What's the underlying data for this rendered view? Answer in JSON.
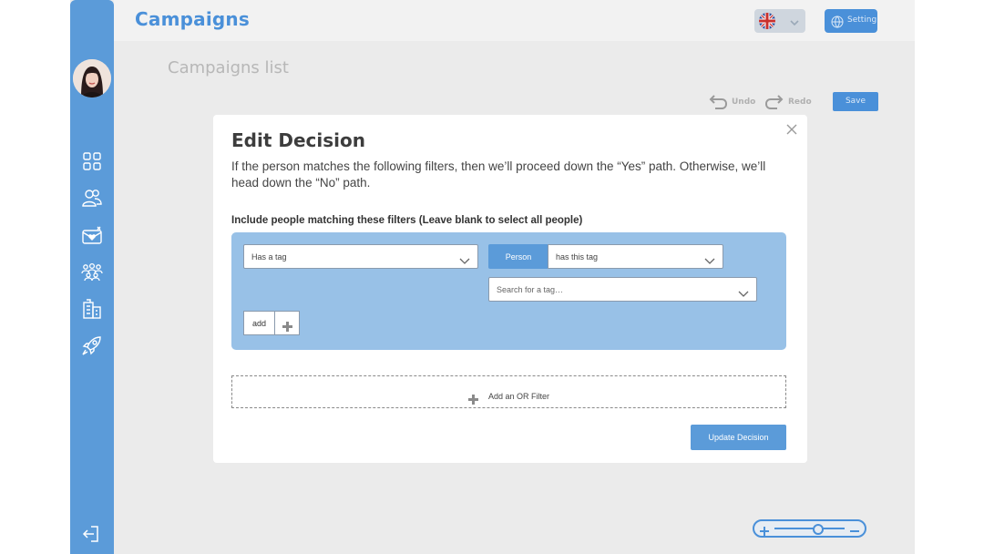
{
  "app": {
    "title": "Campaigns",
    "page_heading": "Campaigns list",
    "setting_label": "Setting",
    "undo_label": "Undo",
    "redo_label": "Redo",
    "save_label": "Save",
    "language": "en-GB",
    "zoom_level": 0.62,
    "colors": {
      "accent": "#5b9bd9",
      "brand_title": "#4a90d9",
      "filter_panel": "#98c1e7"
    }
  },
  "sidebar": {
    "items": [
      {
        "icon": "dashboard-grid-icon"
      },
      {
        "icon": "contacts-icon"
      },
      {
        "icon": "campaign-mail-icon"
      },
      {
        "icon": "community-icon"
      },
      {
        "icon": "buildings-icon"
      },
      {
        "icon": "rocket-icon"
      }
    ],
    "footer_icon": "logout-icon"
  },
  "modal": {
    "title": "Edit Decision",
    "description": "If the person matches the following filters, then we’ll proceed down the “Yes” path. Otherwise, we’ll head down the “No” path.",
    "filters_label": "Include people matching these filters (Leave blank to select all people)",
    "condition_type": "Has a tag",
    "subject": "Person",
    "operator": "has this tag",
    "tag_search_placeholder": "Search for a tag…",
    "add_label": "add",
    "or_filter_label": "Add an OR Filter",
    "submit_label": "Update Decision"
  }
}
